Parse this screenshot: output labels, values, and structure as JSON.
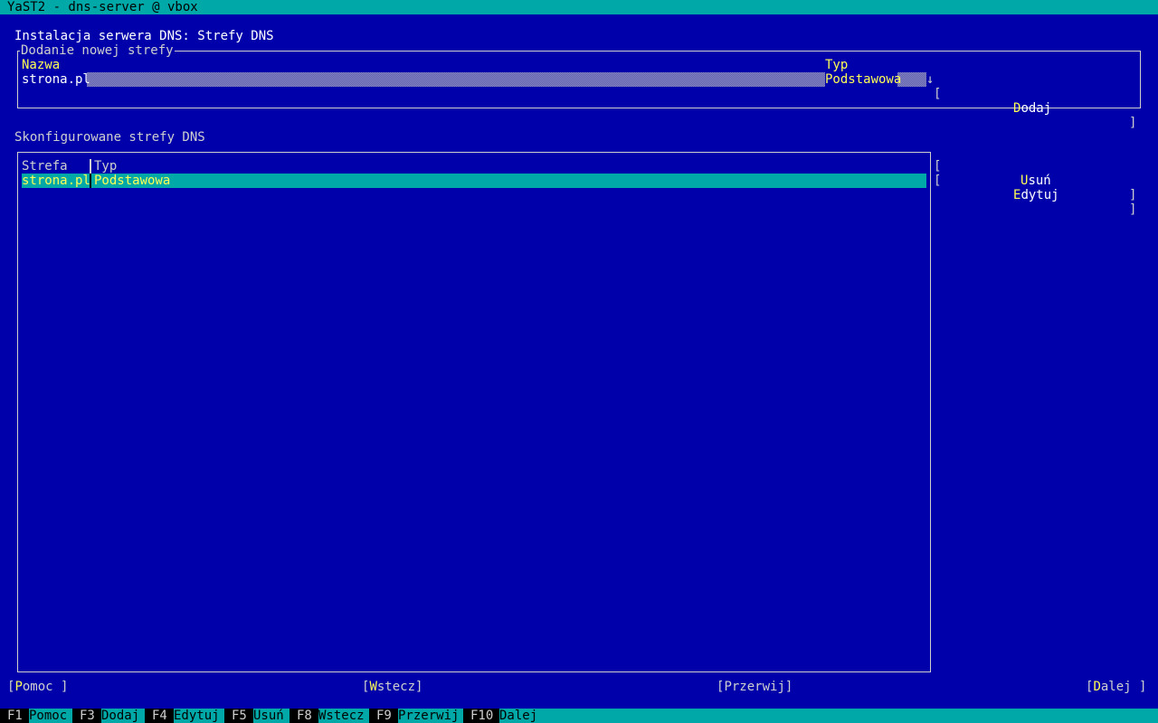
{
  "window": {
    "title": "YaST2 - dns-server @ vbox"
  },
  "page": {
    "heading": "Instalacja serwera DNS: Strefy DNS"
  },
  "add_zone": {
    "frame_label": "Dodanie nowej strefy",
    "name_label": "Nazwa",
    "type_label": "Typ",
    "name_value": "strona.pl",
    "type_value": "Podstawowa",
    "dropdown_arrow": "↓",
    "add_button": {
      "open": "[",
      "hot": "D",
      "rest": "odaj",
      "close": "]"
    }
  },
  "configured": {
    "label": "Skonfigurowane strefy DNS",
    "columns": [
      "Strefa",
      "Typ"
    ],
    "rows": [
      {
        "zone": "strona.pl",
        "type": "Podstawowa"
      }
    ],
    "delete_button": {
      "open": "[",
      "hot": "U",
      "rest": "suń",
      "close": "]"
    },
    "edit_button": {
      "open": "[",
      "hot": "E",
      "rest": "dytuj",
      "close": "]"
    }
  },
  "nav": {
    "help": {
      "open": "[",
      "hot": "P",
      "rest": "omoc ]"
    },
    "back": {
      "open": "[",
      "hot": "W",
      "rest": "stecz]"
    },
    "abort": {
      "open": "[",
      "hot": "P",
      "rest": "rzerwij]"
    },
    "next": {
      "open": "[",
      "hot": "D",
      "rest": "alej ]"
    }
  },
  "fkeys": [
    {
      "key": "F1",
      "label": "Pomoc"
    },
    {
      "key": "F3",
      "label": "Dodaj"
    },
    {
      "key": "F4",
      "label": "Edytuj"
    },
    {
      "key": "F5",
      "label": "Usuń"
    },
    {
      "key": "F8",
      "label": "Wstecz"
    },
    {
      "key": "F9",
      "label": "Przerwij"
    },
    {
      "key": "F10",
      "label": "Dalej"
    }
  ],
  "colors": {
    "background": "#0000aa",
    "titlebar": "#00a8a8",
    "highlight": "#ffff55",
    "text": "#cfcfcf"
  }
}
